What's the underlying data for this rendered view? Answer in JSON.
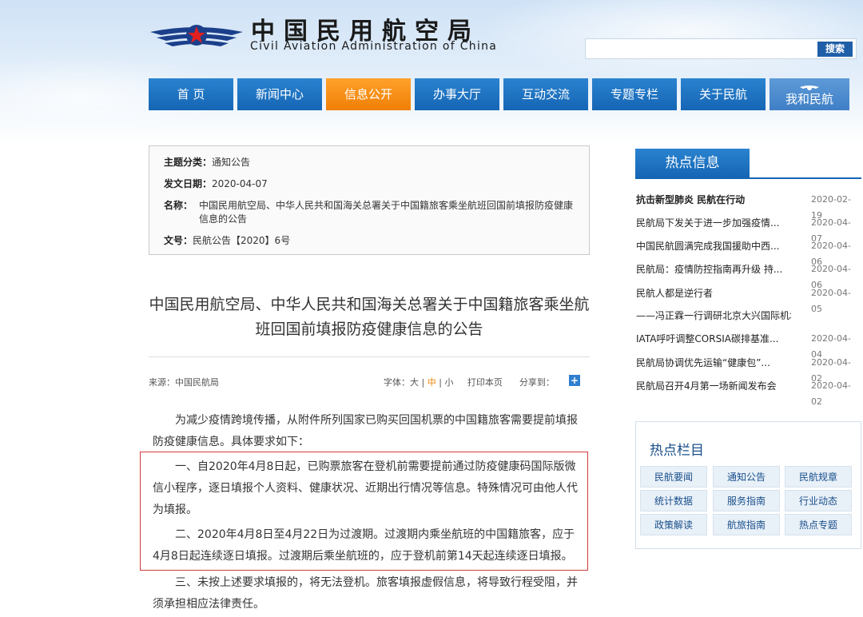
{
  "header": {
    "title_cn": "中国民用航空局",
    "title_en": "Civil Aviation Administration of China",
    "search_button": "搜索",
    "search_value": ""
  },
  "nav": [
    {
      "label": "首 页",
      "active": false
    },
    {
      "label": "新闻中心",
      "active": false
    },
    {
      "label": "信息公开",
      "active": true
    },
    {
      "label": "办事大厅",
      "active": false
    },
    {
      "label": "互动交流",
      "active": false
    },
    {
      "label": "专题专栏",
      "active": false
    },
    {
      "label": "关于民航",
      "active": false
    },
    {
      "label": "我和民航",
      "active": false
    }
  ],
  "info": {
    "category_label": "主题分类：",
    "category_value": "通知公告",
    "date_label": "发文日期：",
    "date_value": "2020-04-07",
    "name_label": "名称：",
    "name_value": "中国民用航空局、中华人民共和国海关总署关于中国籍旅客乘坐航班回国前填报防疫健康信息的公告",
    "docno_label": "文号：",
    "docno_value": "民航公告【2020】6号"
  },
  "article": {
    "title": "中国民用航空局、中华人民共和国海关总署关于中国籍旅客乘坐航班回国前填报防疫健康信息的公告",
    "source": "来源：中国民航局",
    "font_label": "字体：",
    "font_large": "大",
    "font_mid": "中",
    "font_small": "小",
    "sep": "|",
    "print": "打印本页",
    "share": "分享到：",
    "share_icon": "+",
    "paragraphs": [
      "为减少疫情跨境传播，从附件所列国家已购买回国机票的中国籍旅客需要提前填报防疫健康信息。具体要求如下：",
      "一、自2020年4月8日起，已购票旅客在登机前需要提前通过防疫健康码国际版微信小程序，逐日填报个人资料、健康状况、近期出行情况等信息。特殊情况可由他人代为填报。",
      "二、2020年4月8日至4月22日为过渡期。过渡期内乘坐航班的中国籍旅客，应于4月8日起连续逐日填报。过渡期后乘坐航班的，应于登机前第14天起连续逐日填报。",
      "三、未按上述要求填报的，将无法登机。旅客填报虚假信息，将导致行程受阻，并须承担相应法律责任。"
    ]
  },
  "hot_info": {
    "title": "热点信息",
    "items": [
      {
        "text": "抗击新型肺炎 民航在行动",
        "date": "2020-02-19",
        "bold": true
      },
      {
        "text": "民航局下发关于进一步加强疫情...",
        "date": "2020-04-07"
      },
      {
        "text": "中国民航圆满完成我国援助中西...",
        "date": "2020-04-06"
      },
      {
        "text": "民航局：疫情防控指南再升级 持...",
        "date": "2020-04-06"
      },
      {
        "text": "民航人都是逆行者",
        "date": "2020-04-05"
      },
      {
        "text": "——冯正霖一行调研北京大兴国际机场",
        "date": ""
      },
      {
        "text": "IATA呼吁调整CORSIA碳排基准...",
        "date": "2020-04-04"
      },
      {
        "text": "民航局协调优先运输“健康包”...",
        "date": "2020-04-02"
      },
      {
        "text": "民航局召开4月第一场新闻发布会",
        "date": "2020-04-02"
      }
    ]
  },
  "hot_columns": {
    "title": "热点栏目",
    "items": [
      "民航要闻",
      "通知公告",
      "民航规章",
      "统计数据",
      "服务指南",
      "行业动态",
      "政策解读",
      "航旅指南",
      "热点专题"
    ]
  },
  "colors": {
    "nav_blue": "#1565b4",
    "nav_active": "#f07f06",
    "highlight_border": "#d23a3a"
  }
}
